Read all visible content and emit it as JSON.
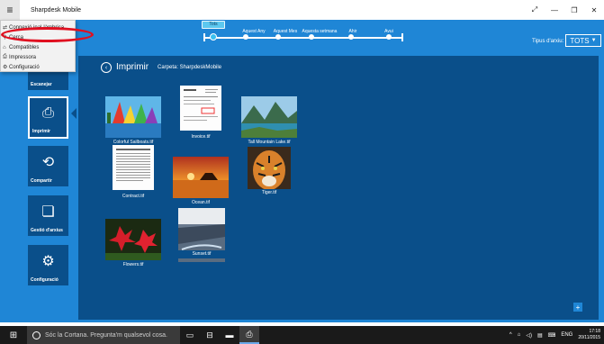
{
  "window": {
    "title": "Sharpdesk Mobile",
    "menu_icon": "hamburger-icon",
    "controls": [
      "expand-icon",
      "minimize-icon",
      "maximize-icon",
      "close-icon"
    ]
  },
  "menu": {
    "items": [
      {
        "icon": "connect-icon",
        "label": "Connexió inal·làmbrica"
      },
      {
        "icon": "search-icon",
        "label": "Cerca"
      },
      {
        "icon": "compatibility-icon",
        "label": "Compatibles"
      },
      {
        "icon": "printer-icon",
        "label": "Impressora"
      },
      {
        "icon": "gear-icon",
        "label": "Configuració"
      }
    ]
  },
  "timeline": {
    "tag": "Tots",
    "points": [
      "Aquest Any",
      "Aquest Mes",
      "Aquesta setmana",
      "Ahir",
      "Avui"
    ]
  },
  "filter": {
    "label": "Tipus d'arxiu:",
    "value": "TOTS"
  },
  "sidebar": {
    "items": [
      {
        "label": "Escanejar",
        "icon": "scanner-icon",
        "active": false
      },
      {
        "label": "Imprimir",
        "icon": "print-icon",
        "active": true
      },
      {
        "label": "Compartir",
        "icon": "share-icon",
        "active": false
      },
      {
        "label": "Gestió d'arxius",
        "icon": "files-icon",
        "active": false
      },
      {
        "label": "Configuració",
        "icon": "gear-icon",
        "active": false
      }
    ]
  },
  "main": {
    "title": "Imprimir",
    "folder": "Carpeta: SharpdeskMobile",
    "files": [
      {
        "name": "Colorful Sailboats.tif",
        "kind": "image"
      },
      {
        "name": "Invoice.tif",
        "kind": "document"
      },
      {
        "name": "Tall Mountain Lake.tif",
        "kind": "image"
      },
      {
        "name": "Contract.tif",
        "kind": "document"
      },
      {
        "name": "Ocean.tif",
        "kind": "image"
      },
      {
        "name": "Tiger.tif",
        "kind": "image"
      },
      {
        "name": "Flowers.tif",
        "kind": "image"
      },
      {
        "name": "Sunset.tif",
        "kind": "image"
      }
    ],
    "add_button": "+"
  },
  "taskbar": {
    "search_placeholder": "Sóc la Cortana. Pregunta'm qualsevol cosa.",
    "lang": "ENG",
    "time": "17:18",
    "date": "20/11/2015"
  },
  "colors": {
    "header_blue": "#1f86d6",
    "content_navy": "#0a4f8a",
    "highlight_red": "#e01020"
  }
}
